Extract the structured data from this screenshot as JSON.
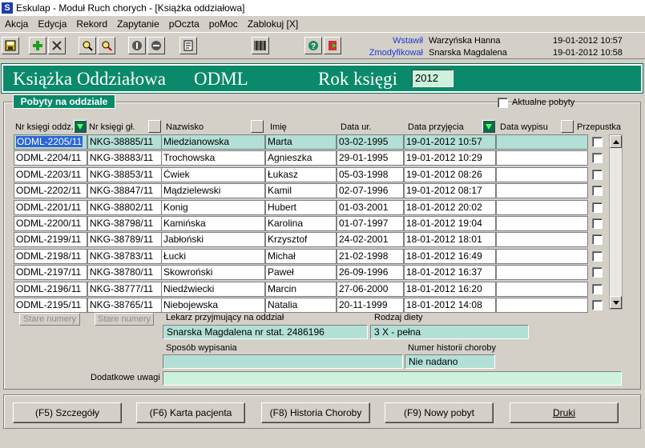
{
  "window": {
    "title": "Eskulap - Moduł Ruch chorych - [Książka oddziałowa]",
    "app_icon": "S"
  },
  "menu": [
    "Akcja",
    "Edycja",
    "Rekord",
    "Zapytanie",
    "pOczta",
    "poMoc",
    "Zablokuj [X]"
  ],
  "record_info": {
    "inserted_label": "Wstawił",
    "inserted_by": "Warzyńska Hanna",
    "inserted_date": "19-01-2012 10:57",
    "modified_label": "Zmodyfikował",
    "modified_by": "Snarska Magdalena",
    "modified_date": "19-01-2012 10:58"
  },
  "banner": {
    "title": "Książka Oddziałowa",
    "code": "ODML",
    "year_label": "Rok księgi",
    "year_value": "2012"
  },
  "tab_label": "Pobyty na oddziale",
  "current_stays_label": "Aktualne pobyty",
  "columns": [
    "Nr księgi oddz.",
    "Nr księgi gł.",
    "Nazwisko",
    "Imię",
    "Data ur.",
    "Data przyjęcia",
    "Data wypisu",
    "Przepustka"
  ],
  "rows": [
    [
      "ODML-2205/11",
      "NKG-38885/11",
      "Miedzianowska",
      "Marta",
      "03-02-1995",
      "19-01-2012 10:57",
      ""
    ],
    [
      "ODML-2204/11",
      "NKG-38883/11",
      "Trochowska",
      "Agnieszka",
      "29-01-1995",
      "19-01-2012 10:29",
      ""
    ],
    [
      "ODML-2203/11",
      "NKG-38853/11",
      "Ćwiek",
      "Łukasz",
      "05-03-1998",
      "19-01-2012 08:26",
      ""
    ],
    [
      "ODML-2202/11",
      "NKG-38847/11",
      "Mądzielewski",
      "Kamil",
      "02-07-1996",
      "19-01-2012 08:17",
      ""
    ],
    [
      "ODML-2201/11",
      "NKG-38802/11",
      "Konig",
      "Hubert",
      "01-03-2001",
      "18-01-2012 20:02",
      ""
    ],
    [
      "ODML-2200/11",
      "NKG-38798/11",
      "Kamińska",
      "Karolina",
      "01-07-1997",
      "18-01-2012 19:04",
      ""
    ],
    [
      "ODML-2199/11",
      "NKG-38789/11",
      "Jabłoński",
      "Krzysztof",
      "24-02-2001",
      "18-01-2012 18:01",
      ""
    ],
    [
      "ODML-2198/11",
      "NKG-38783/11",
      "Łucki",
      "Michał",
      "21-02-1998",
      "18-01-2012 16:49",
      ""
    ],
    [
      "ODML-2197/11",
      "NKG-38780/11",
      "Skowroński",
      "Paweł",
      "26-09-1996",
      "18-01-2012 16:37",
      ""
    ],
    [
      "ODML-2196/11",
      "NKG-38777/11",
      "Niedźwiecki",
      "Marcin",
      "27-06-2000",
      "18-01-2012 16:20",
      ""
    ],
    [
      "ODML-2195/11",
      "NKG-38765/11",
      "Niebojewska",
      "Natalia",
      "20-11-1999",
      "18-01-2012 14:08",
      ""
    ]
  ],
  "old_numbers_label": "Stare numery",
  "details": {
    "doctor_label": "Lekarz przyjmujący na oddział",
    "doctor_value": "Snarska Magdalena nr stat. 2486196",
    "diet_label": "Rodzaj diety",
    "diet_value": "3 X - pełna",
    "discharge_label": "Sposób wypisania",
    "discharge_value": "",
    "history_label": "Numer historii choroby",
    "history_value": "Nie nadano",
    "notes_label": "Dodatkowe uwagi",
    "notes_value": ""
  },
  "buttons": [
    "(F5) Szczegóły",
    "(F6) Karta pacjenta",
    "(F8) Historia Choroby",
    "(F9) Nowy pobyt",
    "Druki"
  ],
  "colors": {
    "banner": "#0a8a6a",
    "selected_row": "#b3e0d6",
    "field": "#b3e0d6",
    "label_blue": "#1a3bd1"
  }
}
